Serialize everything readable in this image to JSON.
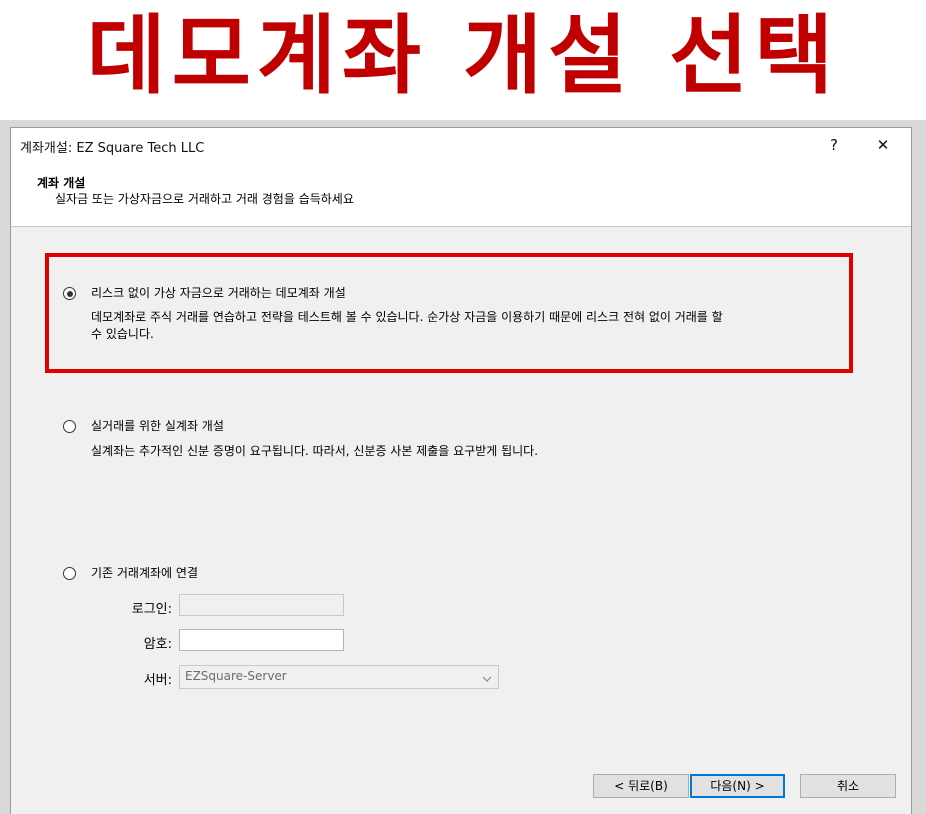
{
  "banner": {
    "text": "데모계좌 개설 선택"
  },
  "window": {
    "title": "계좌개설: EZ Square Tech LLC",
    "help_label": "?",
    "close_label": "✕"
  },
  "header": {
    "title": "계좌 개설",
    "subtitle": "실자금 또는 가상자금으로 거래하고 거래 경험을 습득하세요"
  },
  "options": [
    {
      "label": "리스크 없이 가상 자금으로 거래하는 데모계좌 개설",
      "desc_line1": "데모계좌로 주식 거래를 연습하고 전략을 테스트해 볼 수 있습니다. 순가상 자금을 이용하기 때문에 리스크 전혀 없이 거래를 할",
      "desc_line2": "수 있습니다.",
      "checked": true
    },
    {
      "label": "실거래를 위한 실계좌 개설",
      "desc_line1": "실계좌는 추가적인 신분 증명이 요구됩니다. 따라서, 신분증 사본 제출을 요구받게 됩니다.",
      "checked": false
    },
    {
      "label": "기존 거래계좌에 연결",
      "checked": false
    }
  ],
  "login": {
    "login_label": "로그인:",
    "login_value": "",
    "password_label": "암호:",
    "password_value": "",
    "server_label": "서버:",
    "server_value": "EZSquare-Server"
  },
  "buttons": {
    "back": "< 뒤로(B)",
    "next": "다음(N) >",
    "cancel": "취소"
  },
  "colors": {
    "banner_text": "#c00000",
    "highlight_border": "#e00000",
    "default_button_border": "#0078d7"
  }
}
